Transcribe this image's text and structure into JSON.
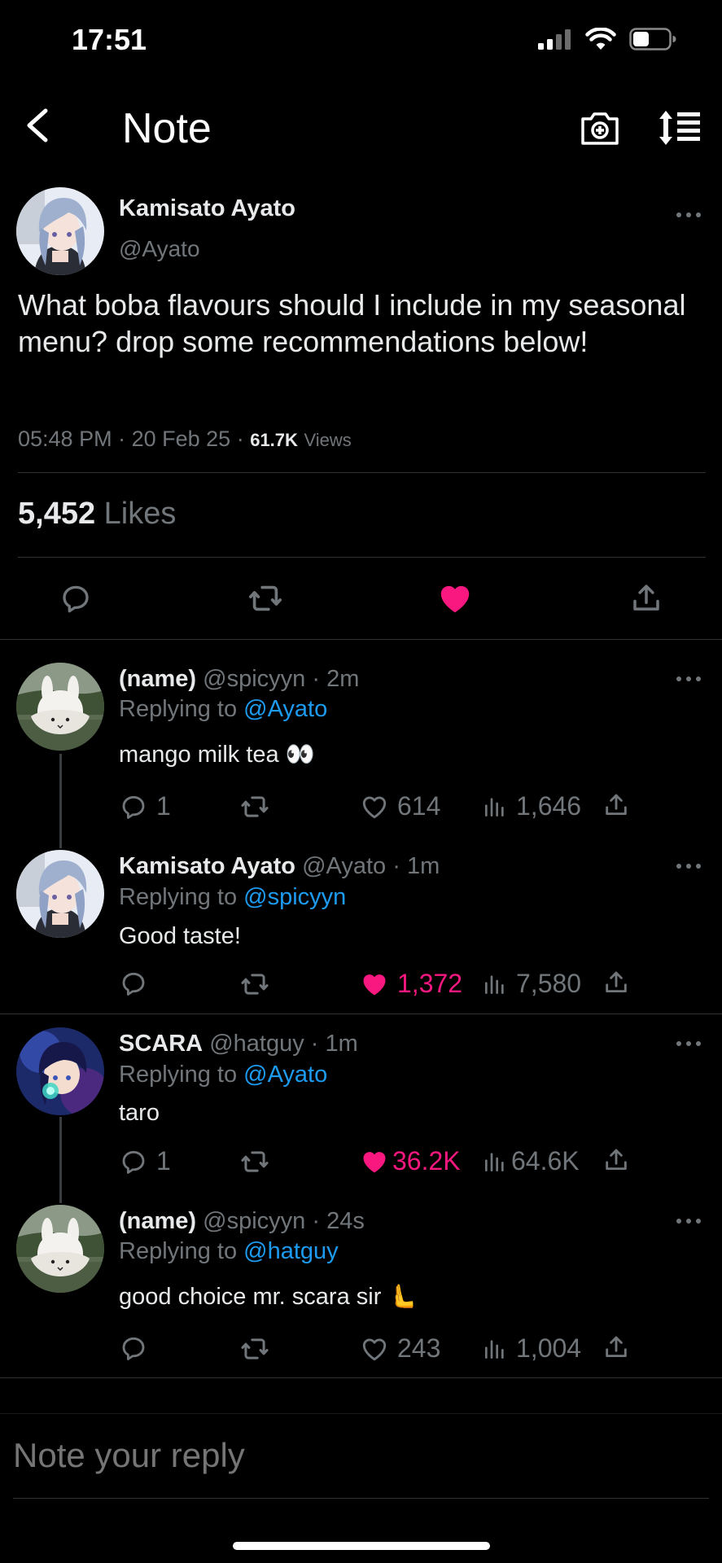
{
  "status_bar": {
    "time": "17:51"
  },
  "header": {
    "title": "Note"
  },
  "post": {
    "author_name": "Kamisato Ayato",
    "author_handle": "@Ayato",
    "text": "What boba flavours should I include in my seasonal menu? drop some recommendations below!",
    "time": "05:48 PM",
    "date": "20 Feb 25",
    "views_count": "61.7K",
    "views_label": "Views",
    "likes_count": "5,452",
    "likes_label": "Likes"
  },
  "replies": [
    {
      "name": "(name)",
      "handle": "@spicyyn",
      "age": "2m",
      "replying_prefix": "Replying to",
      "replying_to": "@Ayato",
      "text": "mango milk tea 👀",
      "reply_count": "1",
      "like_count": "614",
      "liked": false,
      "view_count": "1,646"
    },
    {
      "name": "Kamisato Ayato",
      "handle": "@Ayato",
      "age": "1m",
      "replying_prefix": "Replying to",
      "replying_to": "@spicyyn",
      "text": "Good taste!",
      "reply_count": "",
      "like_count": "1,372",
      "liked": true,
      "view_count": "7,580"
    },
    {
      "name": "SCARA",
      "handle": "@hatguy",
      "age": "1m",
      "replying_prefix": "Replying to",
      "replying_to": "@Ayato",
      "text": "taro",
      "reply_count": "1",
      "like_count": "36.2K",
      "liked": true,
      "view_count": "64.6K"
    },
    {
      "name": "(name)",
      "handle": "@spicyyn",
      "age": "24s",
      "replying_prefix": "Replying to",
      "replying_to": "@hatguy",
      "text": "good choice mr. scara sir 🫷",
      "reply_count": "",
      "like_count": "243",
      "liked": false,
      "view_count": "1,004"
    }
  ],
  "composer": {
    "placeholder": "Note your reply"
  },
  "colors": {
    "like": "#f91880",
    "mention": "#1d9bf0",
    "muted": "#71767b",
    "background": "#000000"
  },
  "icons": [
    "back-icon",
    "camera-icon",
    "sort-icon",
    "more-icon",
    "reply-icon",
    "repost-icon",
    "heart-icon",
    "views-icon",
    "share-icon"
  ]
}
